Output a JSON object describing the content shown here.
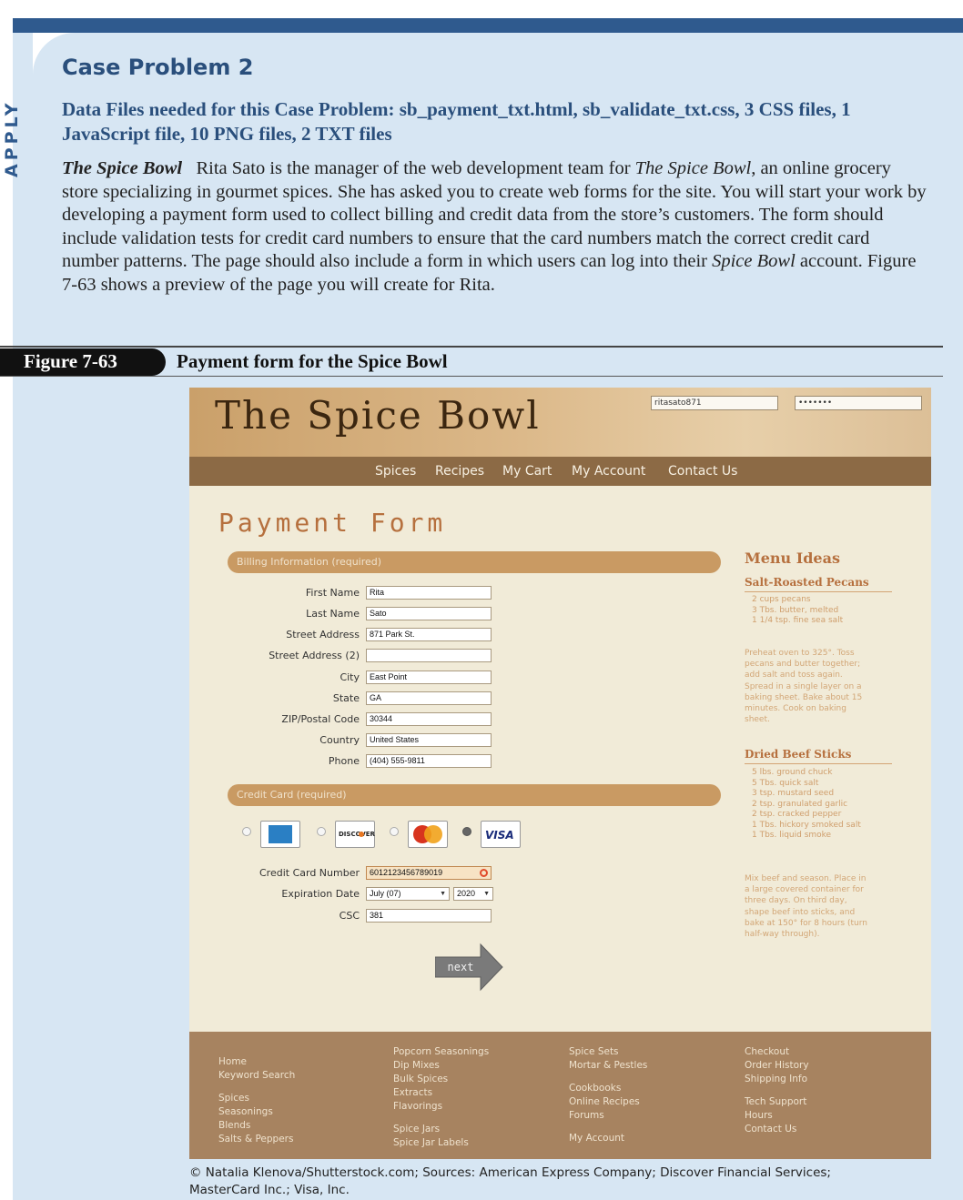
{
  "apply_label": "APPLY",
  "case_title": "Case Problem 2",
  "data_files": "Data Files needed for this Case Problem: sb_payment_txt.html, sb_validate_txt.css, 3 CSS files, 1 JavaScript file, 10 PNG files, 2 TXT files",
  "intro": {
    "lead": "The Spice Bowl",
    "pre_italic_1": "Rita Sato is the manager of the web development team for ",
    "italic_1": "The Spice Bowl",
    "pre_italic_2": ", an online grocery store specializing in gourmet spices. She has asked you to create web forms for the site. You will start your work by developing a payment form used to collect billing and credit data from the store’s customers. The form should include validation tests for credit card numbers to ensure that the card numbers match the correct credit card number patterns. The page should also include a form in which users can log into their ",
    "italic_2": "Spice Bowl",
    "tail": " account. Figure 7-63 shows a preview of the page you will create for Rita."
  },
  "figure": {
    "number": "Figure 7-63",
    "caption": "Payment form for the Spice Bowl"
  },
  "site": {
    "logo": "The Spice Bowl",
    "login": {
      "username": "ritasato871",
      "password": "•••••••"
    },
    "nav": [
      "Spices",
      "Recipes",
      "My Cart",
      "My Account",
      "Contact Us"
    ],
    "page_title": "Payment Form",
    "billing": {
      "legend": "Billing Information (required)",
      "fields": [
        {
          "label": "First Name",
          "value": "Rita"
        },
        {
          "label": "Last Name",
          "value": "Sato"
        },
        {
          "label": "Street Address",
          "value": "871 Park St."
        },
        {
          "label": "Street Address (2)",
          "value": ""
        },
        {
          "label": "City",
          "value": "East Point"
        },
        {
          "label": "State",
          "value": "GA"
        },
        {
          "label": "ZIP/Postal Code",
          "value": "30344"
        },
        {
          "label": "Country",
          "value": "United States"
        },
        {
          "label": "Phone",
          "value": "(404) 555-9811"
        }
      ]
    },
    "credit": {
      "legend": "Credit Card (required)",
      "cards": [
        {
          "name": "American Express",
          "icon": "amex-card-icon",
          "selected": false
        },
        {
          "name": "DISCOVER",
          "icon": "discover-card-icon",
          "selected": false
        },
        {
          "name": "MasterCard",
          "icon": "mastercard-card-icon",
          "selected": false
        },
        {
          "name": "VISA",
          "icon": "visa-card-icon",
          "selected": true
        }
      ],
      "number_label": "Credit Card Number",
      "number_value": "6012123456789019",
      "expiration_label": "Expiration Date",
      "exp_month": "July (07)",
      "exp_year": "2020",
      "csc_label": "CSC",
      "csc_value": "381",
      "next_label": "next"
    },
    "aside": {
      "title": "Menu Ideas",
      "recipes": [
        {
          "name": "Salt-Roasted Pecans",
          "ingredients": [
            "2 cups pecans",
            "3 Tbs. butter, melted",
            "1 1/4 tsp. fine sea salt"
          ],
          "steps": [
            "Preheat oven to 325°. Toss",
            "pecans and butter together;",
            "add salt and toss again.",
            "Spread in a single layer on a",
            "baking sheet. Bake about 15",
            "minutes. Cook on baking",
            "sheet."
          ]
        },
        {
          "name": "Dried Beef Sticks",
          "ingredients": [
            "5 lbs. ground chuck",
            "5 Tbs. quick salt",
            "3 tsp. mustard seed",
            "2 tsp. granulated garlic",
            "2 tsp. cracked pepper",
            "1 Tbs. hickory smoked salt",
            "1 Tbs. liquid smoke"
          ],
          "steps": [
            "Mix beef and season. Place in",
            "a large covered container for",
            "three days. On third day,",
            "shape beef into sticks, and",
            "bake at 150° for 8 hours (turn",
            "half-way through)."
          ]
        }
      ]
    },
    "footer": {
      "col1": [
        "Home",
        "Keyword Search",
        "",
        "Spices",
        "Seasonings",
        "Blends",
        "Salts & Peppers"
      ],
      "col2": [
        "Popcorn Seasonings",
        "Dip Mixes",
        "Bulk Spices",
        "Extracts",
        "Flavorings",
        "",
        "Spice Jars",
        "Spice Jar Labels"
      ],
      "col3": [
        "Spice Sets",
        "Mortar & Pestles",
        "",
        "Cookbooks",
        "Online Recipes",
        "Forums",
        "",
        "My Account"
      ],
      "col4": [
        "Checkout",
        "Order History",
        "Shipping Info",
        "",
        "Tech Support",
        "Hours",
        "Contact Us"
      ]
    }
  },
  "credit_line": "© Natalia Klenova/Shutterstock.com; Sources: American Express Company; Discover Financial Services; MasterCard Inc.; Visa, Inc.",
  "colors": {
    "accent_blue": "#2f5a8e",
    "panel_blue": "#d7e6f3",
    "spice_brown": "#8c6a45",
    "heading_orange": "#b6703e"
  }
}
